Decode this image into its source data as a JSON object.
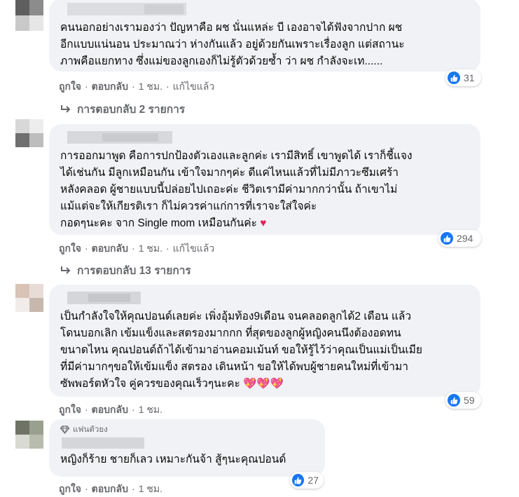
{
  "comments": [
    {
      "text": "คนนอกอย่างเรามองว่า ปัญหาคือ ผช นั่นแหล่ะ บี เองอาจได้ฟังจากปาก ผช\nอีกแบบแน่นอน ประมาณว่า ห่างกันแล้ว อยู่ด้วยกันเพราะเรื่องลูก แต่สถานะ\nภาพคือแยกทาง ซึ่งแม่ของลูกเองก็ไม่รู้ตัวด้วยซ้ำ ว่า ผช กำลังจะเท......",
      "like_count": "31",
      "action_like": "ถูกใจ",
      "action_reply": "ตอบกลับ",
      "time": "1 ชม.",
      "edited": "แก้ไขแล้ว",
      "replies_label": "การตอบกลับ 2 รายการ"
    },
    {
      "text": "การออกมาพูด คือการปกป้องตัวเองและลูกค่ะ เรามีสิทธิ์ เขาพูดได้ เราก็ชี้แจง\nได้เช่นกัน มีลูกเหมือนกัน เข้าใจมากๆค่ะ ดีแค่ไหนแล้วที่ไม่มีภาวะซึมเศร้า\nหลังคลอด ผู้ชายแบบนี้ปล่อยไปเถอะค่ะ ชีวิตเรามีค่ามากกว่านั้น ถ้าเขาไม่\nแม้แต่จะให้เกียรติเรา ก็ไม่ควรค่าแก่การที่เราจะใส่ใจค่ะ\nกอดๆนะคะ จาก Single mom เหมือนกันค่ะ",
      "emoji": "♥",
      "like_count": "294",
      "action_like": "ถูกใจ",
      "action_reply": "ตอบกลับ",
      "time": "1 ชม.",
      "edited": "แก้ไขแล้ว",
      "replies_label": "การตอบกลับ 13 รายการ"
    },
    {
      "text": "เป็นกำลังใจให้คุณปอนด์เลยค่ะ เพิ่งอุ้มท้อง9เดือน จนคลอดลูกได้2 เดือน แล้ว\nโดนบอกเลิก เข้มแข็งและสตรองมากกก ที่สุดของลูกผู้หญิงคนนึงต้องอดทน\nขนาดไหน คุณปอนด์ถ้าได้เข้ามาอ่านคอมเม้นท์ ขอให้รู้ไว้ว่าคุณเป็นแม่เป็นเมีย\nที่มีค่ามากๆขอให้เข้มแข็ง สตรอง เดินหน้า ขอให้ได้พบผู้ชายคนใหม่ที่เข้ามา\nซัพพอร์ตหัวใจ คู่ควรของคุณเร็วๆนะคะ",
      "emoji": "💖💖💖",
      "like_count": "59",
      "action_like": "ถูกใจ",
      "action_reply": "ตอบกลับ",
      "time": "1 ชม."
    },
    {
      "badge": "แฟนตัวยง",
      "text": "หญิงก็ร้าย ชายก็เลว เหมาะกันจ้า สู้ๆนะคุณปอนด์",
      "like_count": "27",
      "action_like": "ถูกใจ",
      "action_reply": "ตอบกลับ",
      "time": "1 ชม."
    }
  ],
  "colors": {
    "bubble": "#f0f2f5",
    "like_blue": "#1877f2",
    "meta_gray": "#65676b"
  },
  "icons": [
    "like-thumb-icon",
    "reply-arrow-icon",
    "diamond-badge-icon"
  ]
}
